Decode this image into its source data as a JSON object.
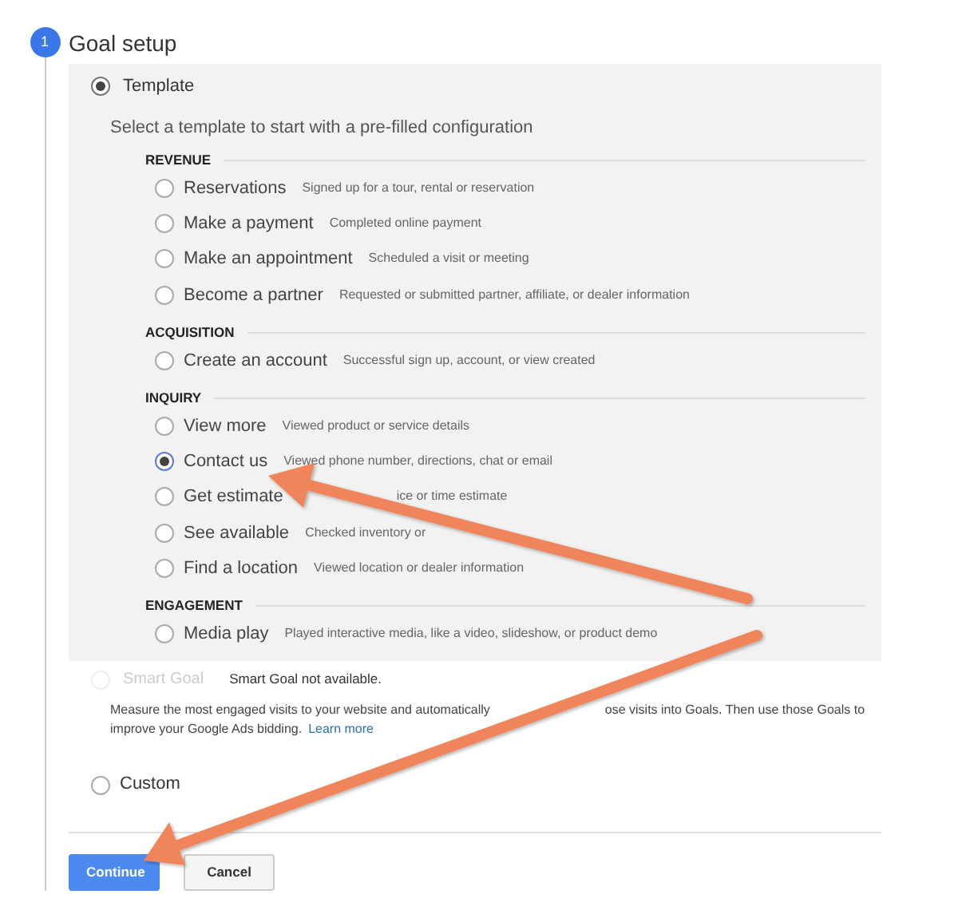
{
  "step": {
    "number": "1",
    "title": "Goal setup"
  },
  "template": {
    "label": "Template",
    "selected": true,
    "description": "Select a template to start with a pre-filled configuration",
    "groups": [
      {
        "heading": "REVENUE",
        "options": [
          {
            "label": "Reservations",
            "description": "Signed up for a tour, rental or reservation",
            "selected": false
          },
          {
            "label": "Make a payment",
            "description": "Completed online payment",
            "selected": false
          },
          {
            "label": "Make an appointment",
            "description": "Scheduled a visit or meeting",
            "selected": false
          },
          {
            "label": "Become a partner",
            "description": "Requested or submitted partner, affiliate, or dealer information",
            "selected": false
          }
        ]
      },
      {
        "heading": "ACQUISITION",
        "options": [
          {
            "label": "Create an account",
            "description": "Successful sign up, account, or view created",
            "selected": false
          }
        ]
      },
      {
        "heading": "INQUIRY",
        "options": [
          {
            "label": "View more",
            "description": "Viewed product or service details",
            "selected": false
          },
          {
            "label": "Contact us",
            "description": "Viewed phone number, directions, chat or email",
            "selected": true
          },
          {
            "label": "Get estimate",
            "description": "ice or time estimate",
            "covered_start": true,
            "selected": false
          },
          {
            "label": "See available",
            "description": "Checked inventory or",
            "selected": false
          },
          {
            "label": "Find a location",
            "description": "Viewed location or dealer information",
            "selected": false
          }
        ]
      },
      {
        "heading": "ENGAGEMENT",
        "options": [
          {
            "label": "Media play",
            "description": "Played interactive media, like a video, slideshow, or product demo",
            "selected": false
          }
        ]
      }
    ]
  },
  "smart_goal": {
    "label": "Smart Goal",
    "disabled": true,
    "selected": false,
    "note": "Smart Goal not available.",
    "description": [
      "Measure the most engaged visits to your website and automatically",
      "ose visits into Goals. Then use those Goals to",
      "improve your Google Ads bidding."
    ],
    "link": "Learn more"
  },
  "custom": {
    "label": "Custom",
    "selected": false
  },
  "buttons": [
    {
      "label": "Continue",
      "kind": "primary"
    },
    {
      "label": "Cancel",
      "kind": "secondary"
    }
  ]
}
